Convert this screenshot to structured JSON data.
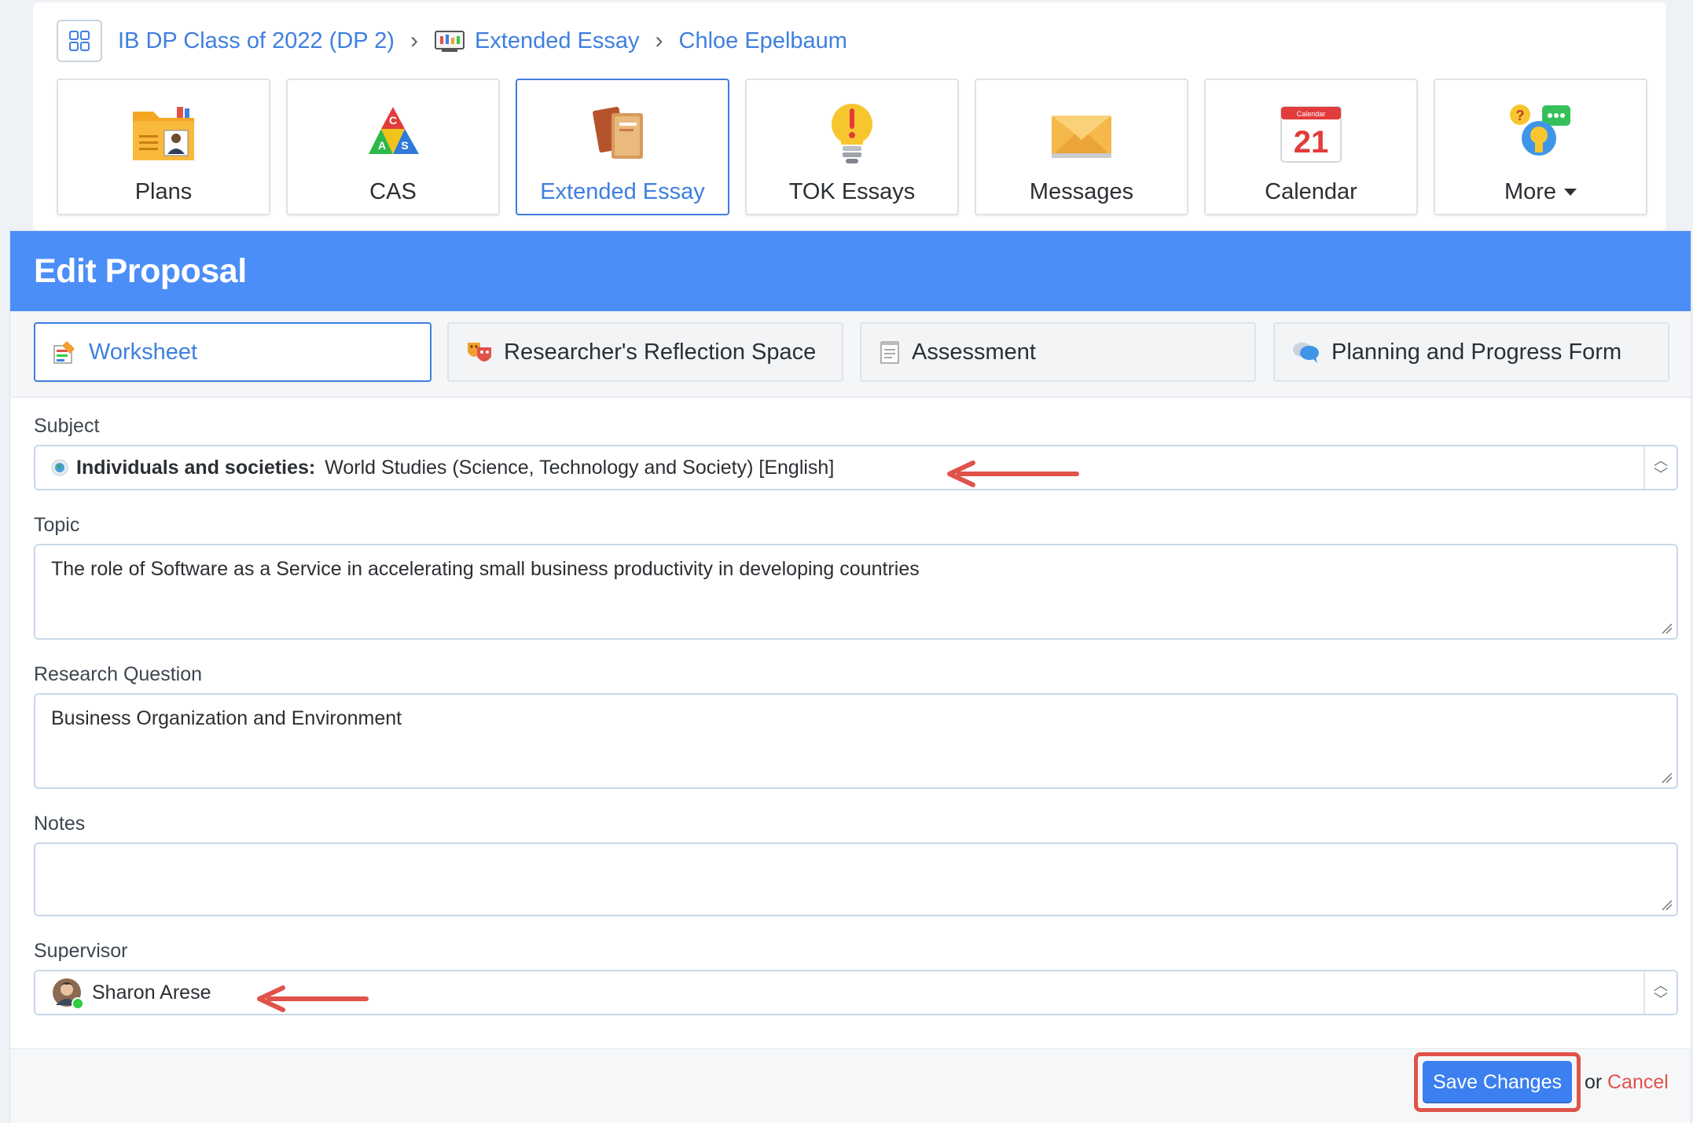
{
  "breadcrumb": {
    "class": "IB DP Class of 2022 (DP 2)",
    "section": "Extended Essay",
    "student": "Chloe Epelbaum"
  },
  "apps": [
    {
      "label": "Plans",
      "icon": "folder-person-icon"
    },
    {
      "label": "CAS",
      "icon": "cas-triangle-icon"
    },
    {
      "label": "Extended Essay",
      "icon": "books-icon",
      "active": true
    },
    {
      "label": "TOK Essays",
      "icon": "lightbulb-icon"
    },
    {
      "label": "Messages",
      "icon": "envelope-icon"
    },
    {
      "label": "Calendar",
      "icon": "calendar-icon",
      "day": "21",
      "header": "Calendar"
    },
    {
      "label": "More",
      "icon": "help-chat-icon",
      "dropdown": true
    }
  ],
  "panel": {
    "title": "Edit Proposal"
  },
  "tabs": [
    {
      "label": "Worksheet",
      "icon": "worksheet-icon",
      "active": true
    },
    {
      "label": "Researcher's Reflection Space",
      "icon": "theater-masks-icon"
    },
    {
      "label": "Assessment",
      "icon": "notepad-icon"
    },
    {
      "label": "Planning and Progress Form",
      "icon": "chat-bubbles-icon"
    }
  ],
  "form": {
    "subject": {
      "label": "Subject",
      "category": "Individuals and societies:",
      "value": "World Studies (Science, Technology and Society) [English]"
    },
    "topic": {
      "label": "Topic",
      "value": "The role of Software as a Service in accelerating small business productivity in developing countries"
    },
    "research_question": {
      "label": "Research Question",
      "value": "Business Organization and Environment"
    },
    "notes": {
      "label": "Notes",
      "value": ""
    },
    "supervisor": {
      "label": "Supervisor",
      "value": "Sharon Arese"
    }
  },
  "footer": {
    "save_label": "Save Changes",
    "or_text": "or",
    "cancel_label": "Cancel"
  },
  "colors": {
    "accent": "#3f7fe0",
    "header_bar": "#4c8ef7",
    "annotation_red": "#e0524a",
    "online_green": "#2ecc40"
  }
}
